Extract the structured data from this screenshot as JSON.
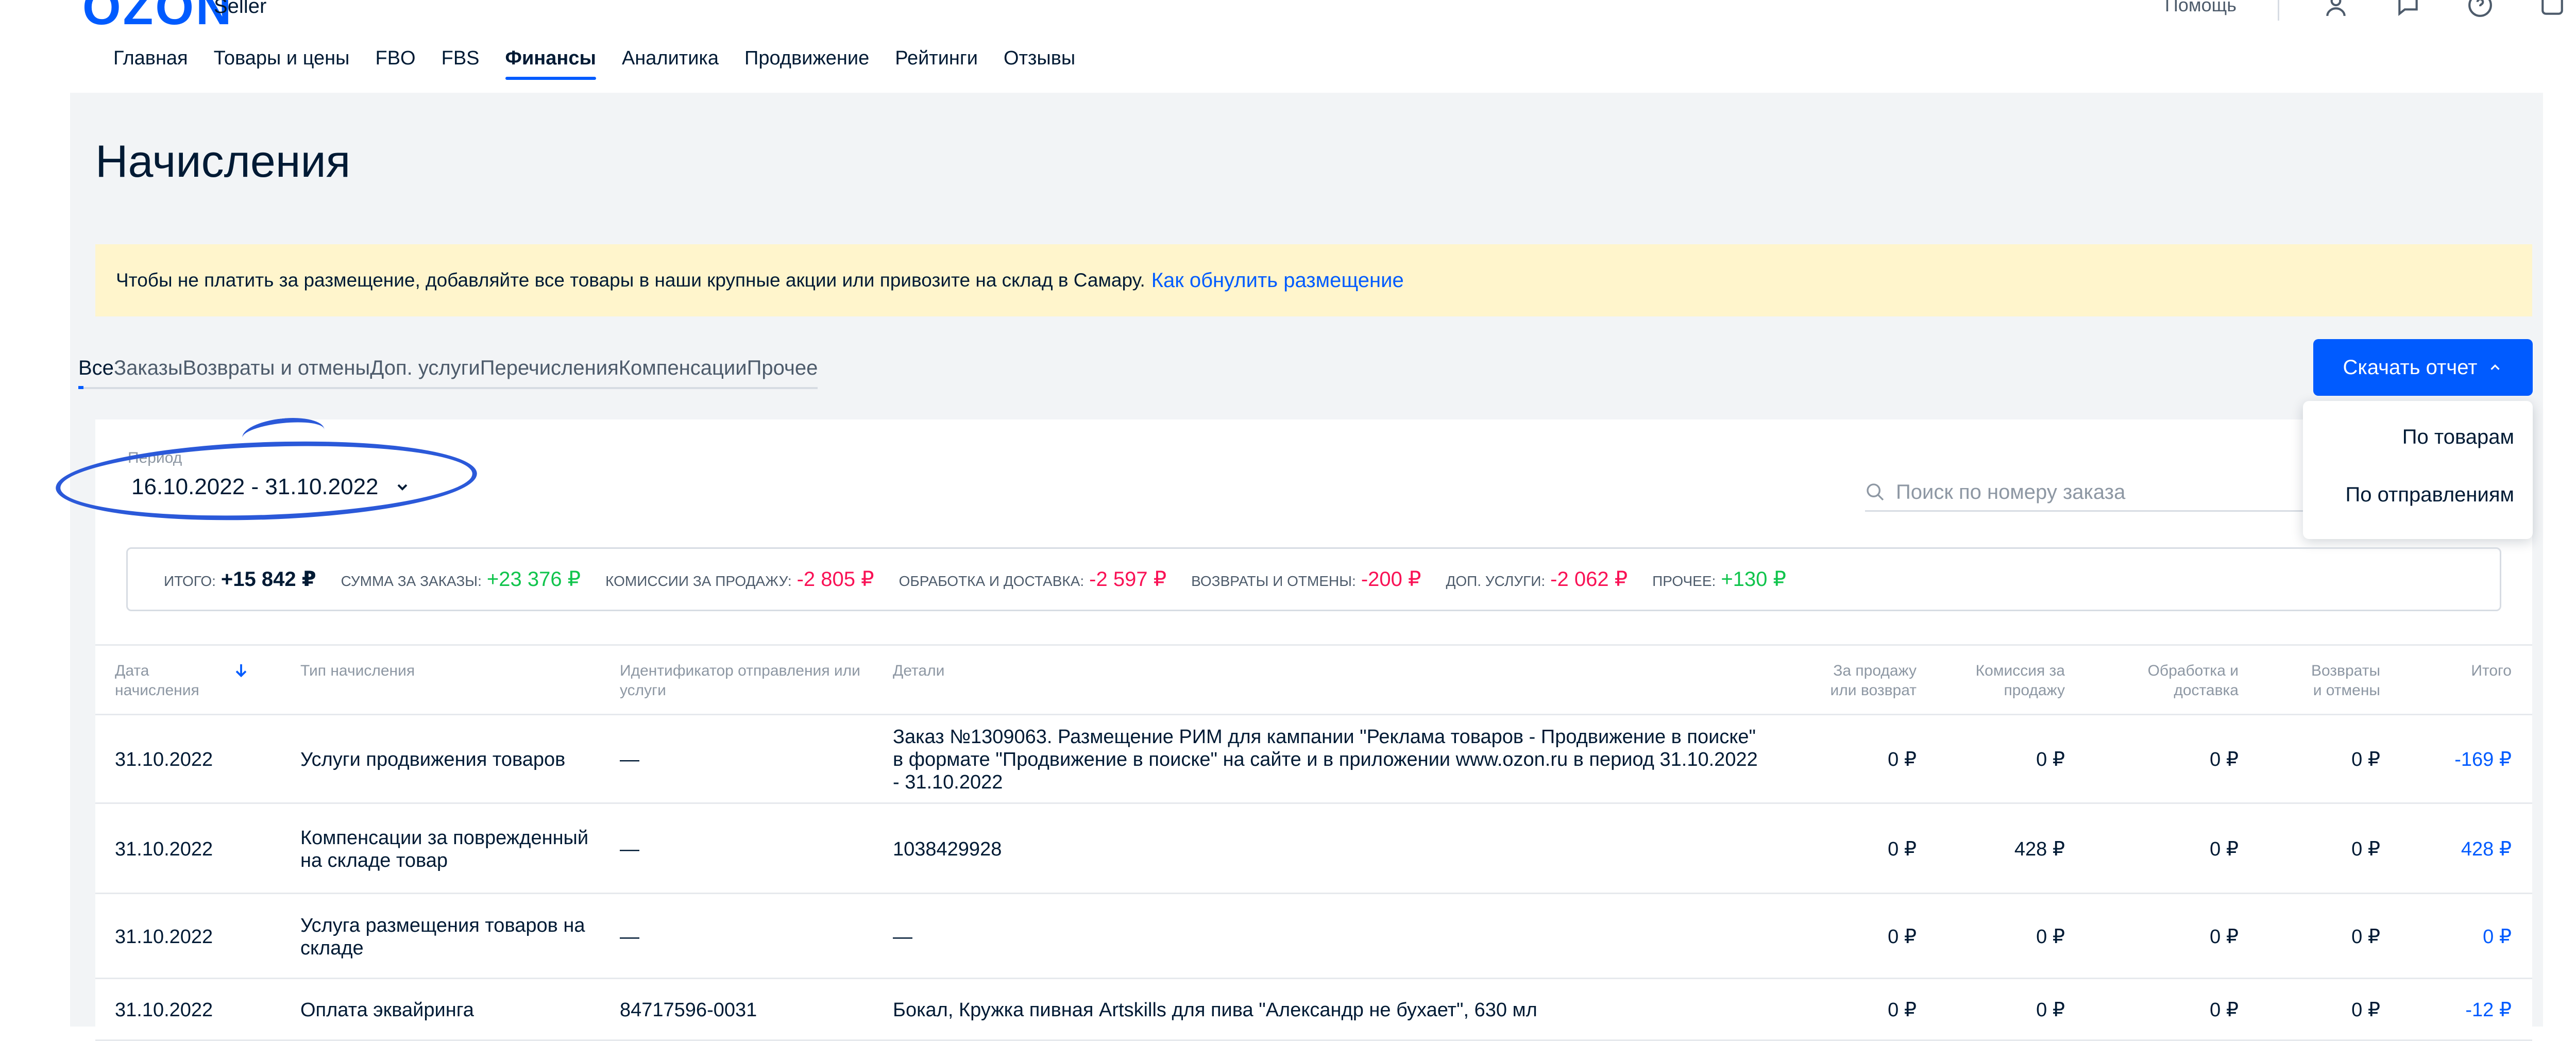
{
  "header": {
    "logo": "OZON",
    "logo_sub": "Seller",
    "right_text": "Помощь"
  },
  "nav": {
    "tabs": [
      "Главная",
      "Товары и цены",
      "FBO",
      "FBS",
      "Финансы",
      "Аналитика",
      "Продвижение",
      "Рейтинги",
      "Отзывы"
    ],
    "active": "Финансы"
  },
  "page": {
    "title": "Начисления"
  },
  "banner": {
    "text": "Чтобы не платить за размещение, добавляйте все товары в наши крупные акции или привозите на склад в Самару.",
    "link": "Как обнулить размещение"
  },
  "subtabs": [
    "Все",
    "Заказы",
    "Возвраты и отмены",
    "Доп. услуги",
    "Перечисления",
    "Компенсации",
    "Прочее"
  ],
  "download": {
    "label": "Скачать отчет",
    "options": [
      "По товарам",
      "По отправлениям"
    ]
  },
  "period": {
    "label": "Период",
    "value": "16.10.2022 - 31.10.2022"
  },
  "search": {
    "placeholder": "Поиск по номеру заказа"
  },
  "summary": [
    {
      "label": "Итого:",
      "value": "+15 842 ₽",
      "tone": "total"
    },
    {
      "label": "Сумма за заказы:",
      "value": "+23 376 ₽",
      "tone": "pos"
    },
    {
      "label": "Комиссии за продажу:",
      "value": "-2 805 ₽",
      "tone": "neg"
    },
    {
      "label": "Обработка и доставка:",
      "value": "-2 597 ₽",
      "tone": "neg"
    },
    {
      "label": "Возвраты и отмены:",
      "value": "-200 ₽",
      "tone": "neg"
    },
    {
      "label": "Доп. услуги:",
      "value": "-2 062 ₽",
      "tone": "neg"
    },
    {
      "label": "Прочее:",
      "value": "+130 ₽",
      "tone": "pos"
    }
  ],
  "table": {
    "headers": {
      "date": "Дата начисления",
      "type": "Тип начисления",
      "id": "Идентификатор отправления или услуги",
      "details": "Детали",
      "sale": "За продажу или возврат",
      "commission": "Комиссия за продажу",
      "processing": "Обработка и доставка",
      "returns": "Возвраты и отмены",
      "total": "Итого"
    },
    "rows": [
      {
        "date": "31.10.2022",
        "type": "Услуги продвижения товаров",
        "id": "—",
        "details": "Заказ №1309063. Размещение РИМ для кампании \"Реклама товаров - Продвижение в поиске\" в формате \"Продвижение в поиске\" на сайте и в приложении www.ozon.ru в период 31.10.2022 - 31.10.2022",
        "sale": "0 ₽",
        "commission": "0 ₽",
        "processing": "0 ₽",
        "returns": "0 ₽",
        "total": "-169 ₽"
      },
      {
        "date": "31.10.2022",
        "type": "Компенсации за поврежденный на складе товар",
        "id": "—",
        "details": "1038429928",
        "sale": "0 ₽",
        "commission": "428 ₽",
        "processing": "0 ₽",
        "returns": "0 ₽",
        "total": "428 ₽"
      },
      {
        "date": "31.10.2022",
        "type": "Услуга размещения товаров на складе",
        "id": "—",
        "details": "—",
        "sale": "0 ₽",
        "commission": "0 ₽",
        "processing": "0 ₽",
        "returns": "0 ₽",
        "total": "0 ₽"
      },
      {
        "date": "31.10.2022",
        "type": "Оплата эквайринга",
        "id": "84717596-0031",
        "details": "Бокал, Кружка пивная Artskills для пива \"Александр не бухает\", 630 мл",
        "sale": "0 ₽",
        "commission": "0 ₽",
        "processing": "0 ₽",
        "returns": "0 ₽",
        "total": "-12 ₽"
      }
    ]
  },
  "colors": {
    "accent": "#005bff",
    "positive": "#10c44c",
    "negative": "#f91155",
    "banner_bg": "#fff5cc",
    "highlight_oval": "#2b59d9"
  }
}
